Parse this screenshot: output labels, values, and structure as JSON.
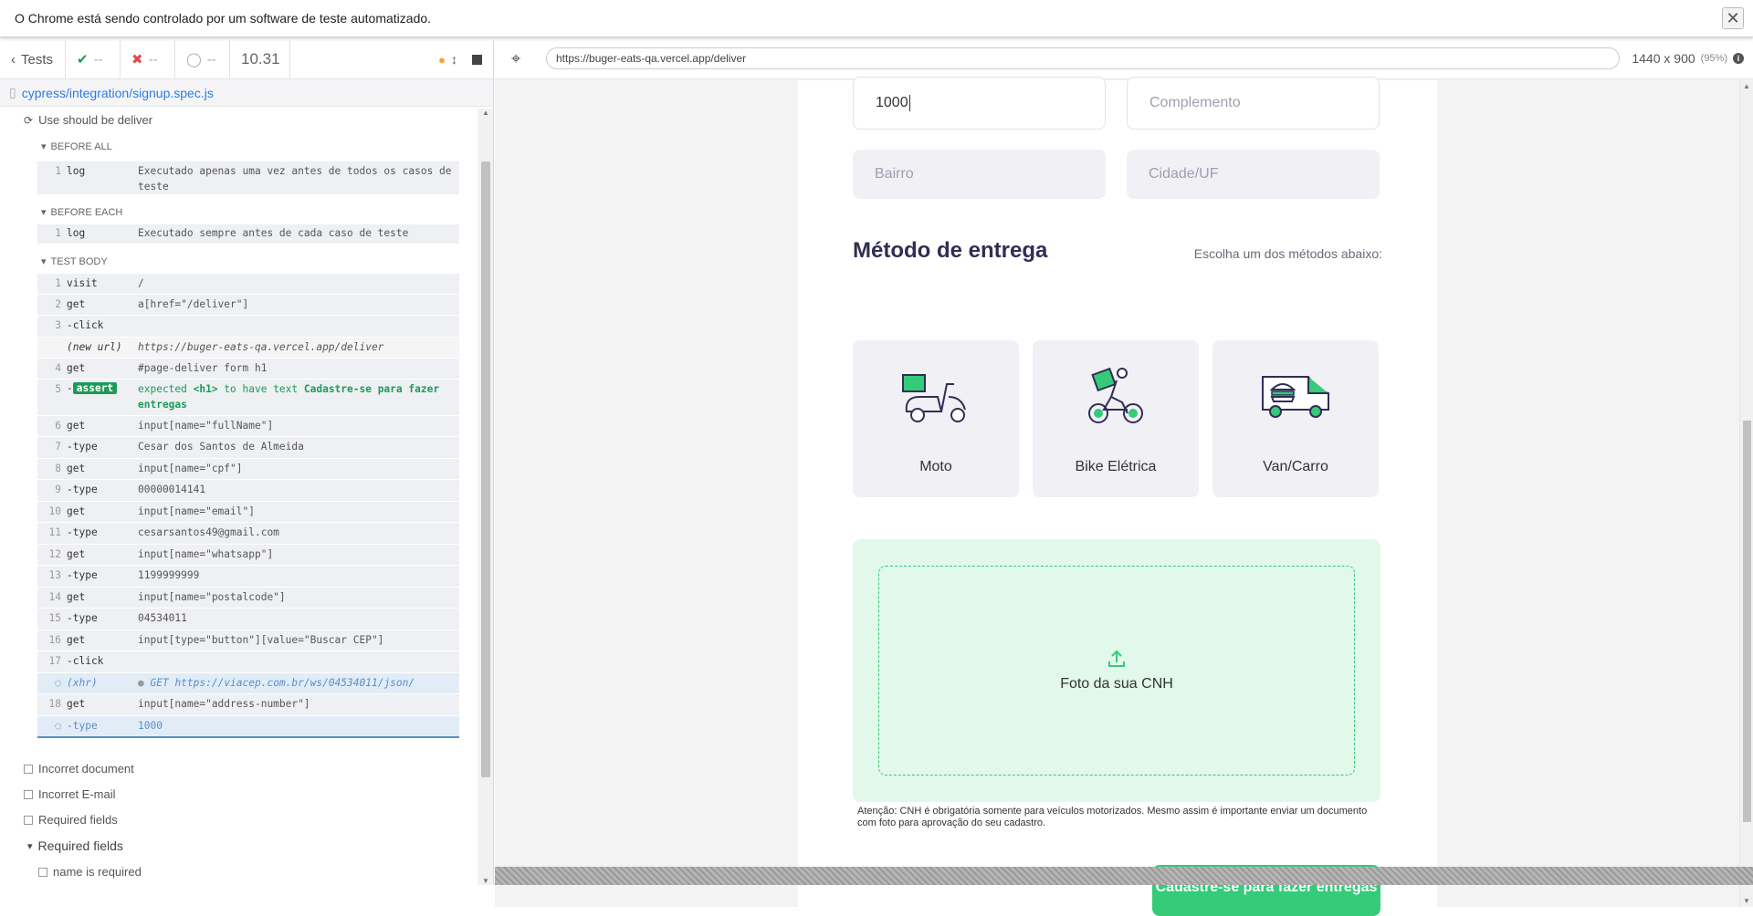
{
  "infobar": {
    "text": "O Chrome está sendo controlado por um software de teste automatizado.",
    "close": "✕"
  },
  "runner": {
    "tests_label": "Tests",
    "passed": "--",
    "failed": "--",
    "pending": "--",
    "duration": "10.31",
    "spec_path": "cypress/integration/signup.spec.js",
    "suite_title": "Use should be deliver",
    "hooks": {
      "before_all": "BEFORE ALL",
      "before_each": "BEFORE EACH",
      "test_body": "TEST BODY"
    },
    "before_all_cmd": {
      "n": "1",
      "name": "log",
      "msg": "Executado apenas uma vez antes de todos os casos de teste"
    },
    "before_each_cmd": {
      "n": "1",
      "name": "log",
      "msg": "Executado sempre antes de cada caso de teste"
    },
    "commands": [
      {
        "n": "1",
        "name": "visit",
        "msg": "/"
      },
      {
        "n": "2",
        "name": "get",
        "msg": "a[href=\"/deliver\"]"
      },
      {
        "n": "3",
        "name": "-click",
        "msg": ""
      },
      {
        "n": "",
        "name": "(new url)",
        "msg": "https://buger-eats-qa.vercel.app/deliver"
      },
      {
        "n": "4",
        "name": "get",
        "msg": "#page-deliver form h1"
      },
      {
        "n": "5",
        "name": "-assert",
        "msg_a": "expected ",
        "msg_b": "<h1>",
        "msg_c": " to have text ",
        "msg_d": "Cadastre-se para fazer entregas"
      },
      {
        "n": "6",
        "name": "get",
        "msg": "input[name=\"fullName\"]"
      },
      {
        "n": "7",
        "name": "-type",
        "msg": "Cesar dos Santos de Almeida"
      },
      {
        "n": "8",
        "name": "get",
        "msg": "input[name=\"cpf\"]"
      },
      {
        "n": "9",
        "name": "-type",
        "msg": "00000014141"
      },
      {
        "n": "10",
        "name": "get",
        "msg": "input[name=\"email\"]"
      },
      {
        "n": "11",
        "name": "-type",
        "msg": "cesarsantos49@gmail.com"
      },
      {
        "n": "12",
        "name": "get",
        "msg": "input[name=\"whatsapp\"]"
      },
      {
        "n": "13",
        "name": "-type",
        "msg": "1199999999"
      },
      {
        "n": "14",
        "name": "get",
        "msg": "input[name=\"postalcode\"]"
      },
      {
        "n": "15",
        "name": "-type",
        "msg": "04534011"
      },
      {
        "n": "16",
        "name": "get",
        "msg": "input[type=\"button\"][value=\"Buscar CEP\"]"
      },
      {
        "n": "17",
        "name": "-click",
        "msg": ""
      },
      {
        "n": "",
        "name": "(xhr)",
        "msg": "GET https://viacep.com.br/ws/04534011/json/"
      },
      {
        "n": "18",
        "name": "get",
        "msg": "input[name=\"address-number\"]"
      },
      {
        "n": "",
        "name": "-type",
        "msg": "1000"
      }
    ],
    "other_tests": [
      "Incorret document",
      "Incorret E-mail",
      "Required fields"
    ],
    "sub_suite": "Required fields",
    "sub_test": "name is required"
  },
  "aut": {
    "url": "https://buger-eats-qa.vercel.app/deliver",
    "viewport": "1440 x 900",
    "viewport_pct": "(95%)",
    "form": {
      "number_value": "1000",
      "complement_placeholder": "Complemento",
      "district_placeholder": "Bairro",
      "city_placeholder": "Cidade/UF",
      "delivery_title": "Método de entrega",
      "delivery_hint": "Escolha um dos métodos abaixo:",
      "methods": [
        "Moto",
        "Bike Elétrica",
        "Van/Carro"
      ],
      "upload_label": "Foto da sua CNH",
      "notice": "Atenção: CNH é obrigatória somente para veículos motorizados. Mesmo assim é importante enviar um documento com foto para aprovação do seu cadastro.",
      "submit": "Cadastre-se para fazer entregas"
    }
  },
  "colors": {
    "brand_green": "#34cb79",
    "title_purple": "#312e55",
    "cypress_blue": "#2a7be4"
  }
}
